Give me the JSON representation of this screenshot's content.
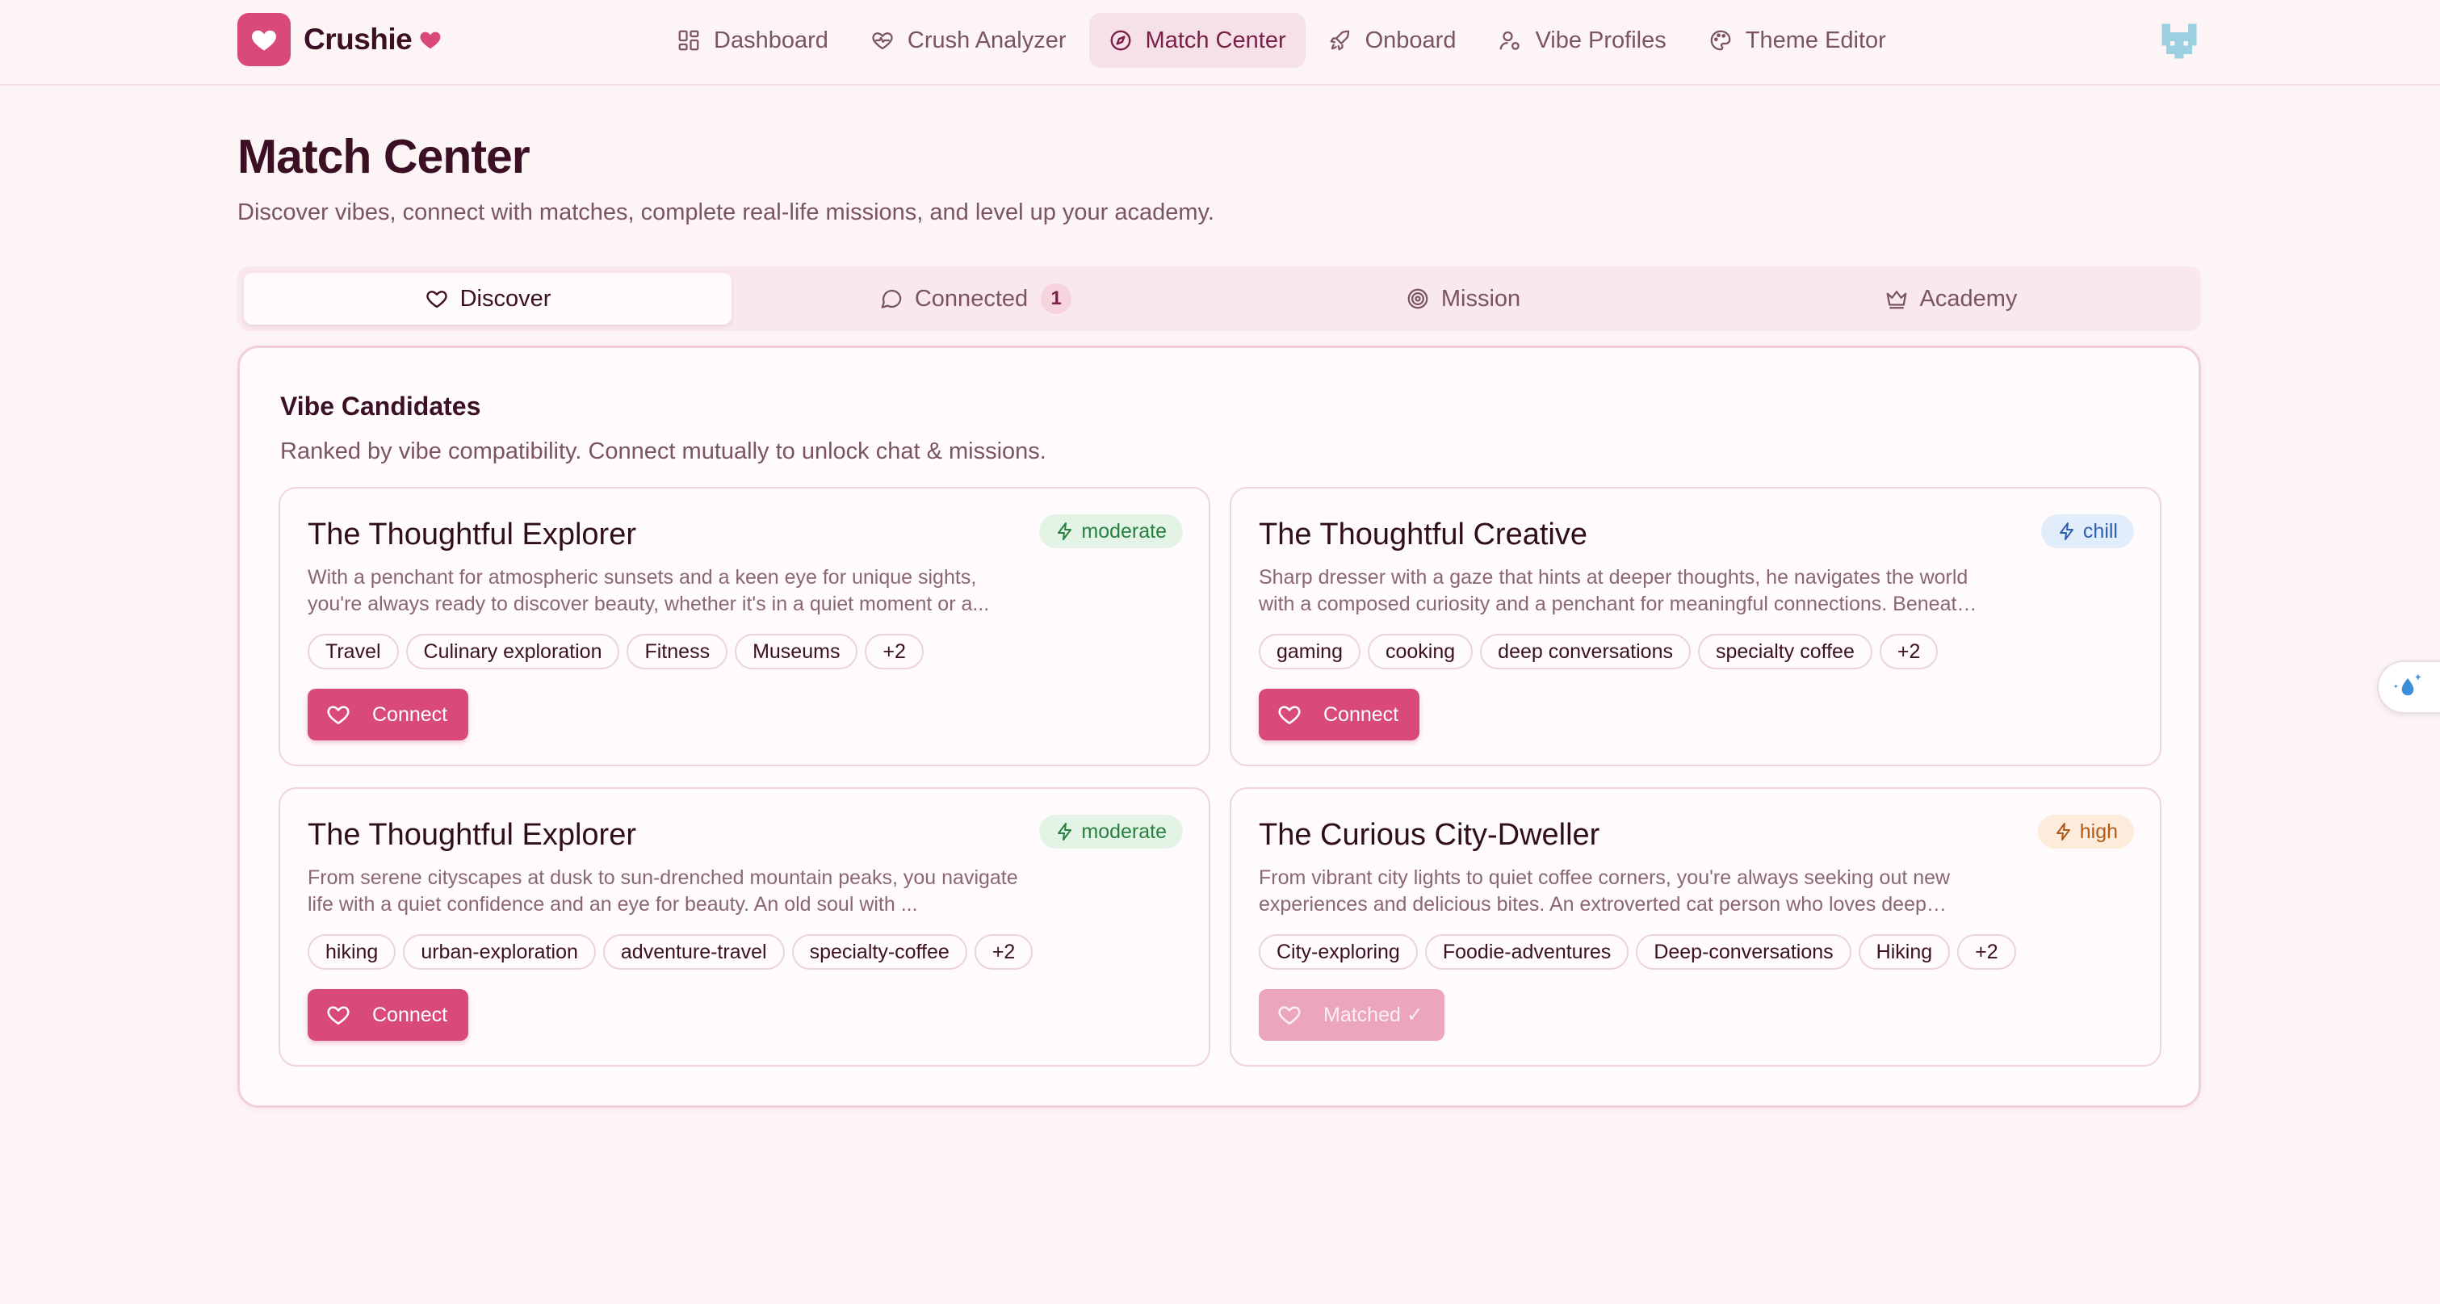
{
  "app": {
    "name": "Crushie",
    "brand_color": "#d94a7b"
  },
  "nav": {
    "items": [
      {
        "label": "Dashboard",
        "icon": "dashboard-grid-icon"
      },
      {
        "label": "Crush Analyzer",
        "icon": "heart-pulse-icon"
      },
      {
        "label": "Match Center",
        "icon": "compass-icon",
        "active": true
      },
      {
        "label": "Onboard",
        "icon": "rocket-icon"
      },
      {
        "label": "Vibe Profiles",
        "icon": "user-profile-icon"
      },
      {
        "label": "Theme Editor",
        "icon": "palette-icon"
      }
    ]
  },
  "header": {
    "title": "Match Center",
    "subtitle": "Discover vibes, connect with matches, complete real-life missions, and level up your academy."
  },
  "tabs": [
    {
      "label": "Discover",
      "icon": "heart-icon",
      "active": true
    },
    {
      "label": "Connected",
      "icon": "chat-bubble-icon",
      "count": "1"
    },
    {
      "label": "Mission",
      "icon": "target-icon"
    },
    {
      "label": "Academy",
      "icon": "crown-icon"
    }
  ],
  "panel": {
    "title": "Vibe Candidates",
    "subtitle": "Ranked by vibe compatibility. Connect mutually to unlock chat & missions."
  },
  "candidates": [
    {
      "title": "The Thoughtful Explorer",
      "badge": "moderate",
      "description": "With a penchant for atmospheric sunsets and a keen eye for unique sights, you're always ready to discover beauty, whether it's in a quiet moment or a...",
      "tags": [
        "Travel",
        "Culinary exploration",
        "Fitness",
        "Museums",
        "+2"
      ],
      "button": "Connect"
    },
    {
      "title": "The Thoughtful Creative",
      "badge": "chill",
      "description": "Sharp dresser with a gaze that hints at deeper thoughts, he navigates the world with a composed curiosity and a penchant for meaningful connections. Beneath t...",
      "tags": [
        "gaming",
        "cooking",
        "deep conversations",
        "specialty coffee",
        "+2"
      ],
      "button": "Connect"
    },
    {
      "title": "The Thoughtful Explorer",
      "badge": "moderate",
      "description": "From serene cityscapes at dusk to sun-drenched mountain peaks, you navigate life with a quiet confidence and an eye for beauty. An old soul with ...",
      "tags": [
        "hiking",
        "urban-exploration",
        "adventure-travel",
        "specialty-coffee",
        "+2"
      ],
      "button": "Connect"
    },
    {
      "title": "The Curious City-Dweller",
      "badge": "high",
      "description": "From vibrant city lights to quiet coffee corners, you're always seeking out new experiences and delicious bites. An extroverted cat person who loves deep talks,...",
      "tags": [
        "City-exploring",
        "Foodie-adventures",
        "Deep-conversations",
        "Hiking",
        "+2"
      ],
      "button": "Matched ✓"
    }
  ]
}
